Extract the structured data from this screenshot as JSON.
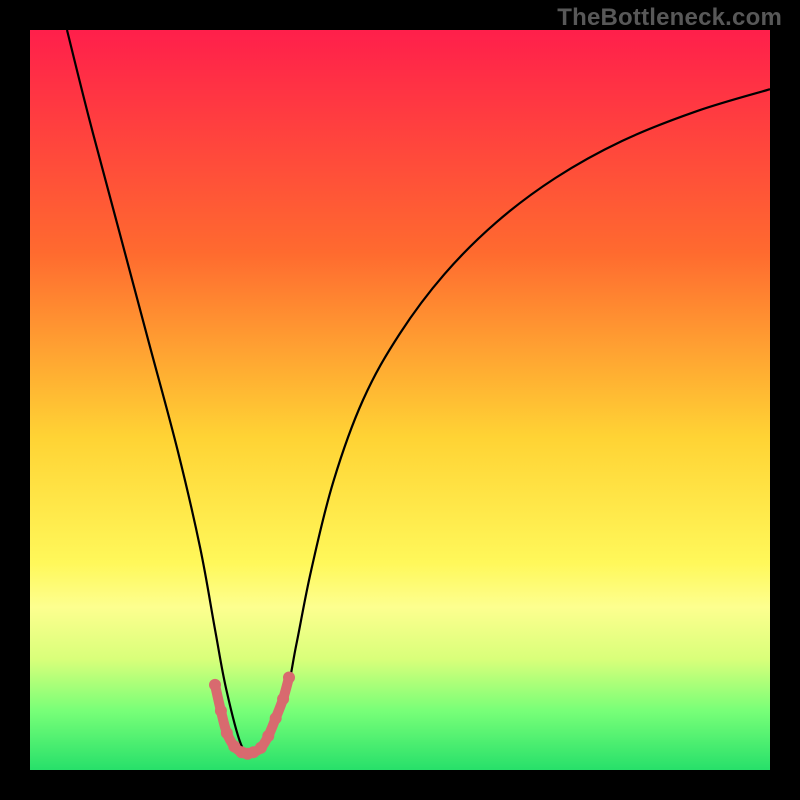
{
  "watermark": "TheBottleneck.com",
  "chart_data": {
    "type": "line",
    "title": "",
    "xlabel": "",
    "ylabel": "",
    "xlim": [
      0,
      100
    ],
    "ylim": [
      0,
      100
    ],
    "gradient_stops": [
      {
        "offset": 0,
        "color": "#ff1f4b"
      },
      {
        "offset": 30,
        "color": "#ff6a2f"
      },
      {
        "offset": 55,
        "color": "#ffd334"
      },
      {
        "offset": 72,
        "color": "#fff85a"
      },
      {
        "offset": 78,
        "color": "#fdff8f"
      },
      {
        "offset": 85,
        "color": "#d9ff7a"
      },
      {
        "offset": 92,
        "color": "#78ff78"
      },
      {
        "offset": 100,
        "color": "#27e06a"
      }
    ],
    "series": [
      {
        "name": "curve",
        "stroke": "#000000",
        "stroke_width": 2.2,
        "x": [
          5,
          8,
          12,
          16,
          20,
          23,
          25,
          26.5,
          28.5,
          30,
          31.5,
          34.5,
          36,
          38,
          41,
          45,
          50,
          56,
          63,
          71,
          80,
          90,
          100
        ],
        "y_value": [
          100,
          88,
          73,
          58,
          43,
          30,
          19,
          11,
          3.5,
          2.2,
          3.5,
          10,
          17,
          27,
          39,
          50,
          59,
          67,
          74,
          80,
          85,
          89,
          92
        ]
      },
      {
        "name": "highlight",
        "stroke": "#d86a6f",
        "stroke_width": 10,
        "linecap": "round",
        "x": [
          25.0,
          25.8,
          26.6,
          27.6,
          28.6,
          29.4,
          30.2,
          31.2,
          32.2,
          33.2,
          34.2,
          35.0
        ],
        "y_value": [
          11.5,
          8.0,
          5.0,
          3.2,
          2.4,
          2.2,
          2.4,
          3.0,
          4.6,
          7.0,
          9.6,
          12.5
        ]
      }
    ]
  }
}
